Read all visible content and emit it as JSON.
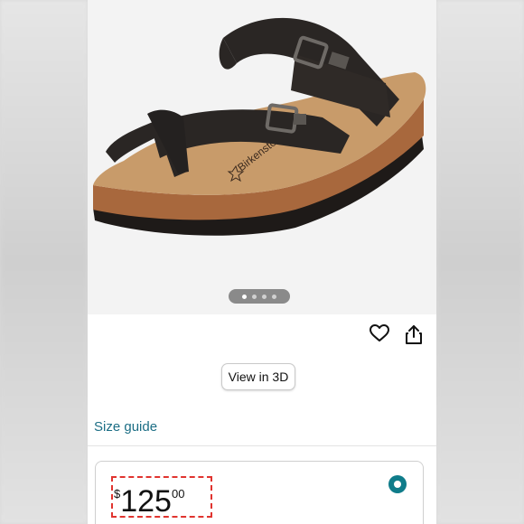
{
  "product": {
    "image_alt": "Black leather toe-loop sandal with two buckle straps and cork footbed",
    "carousel": {
      "total": 4,
      "active": 0
    }
  },
  "actions": {
    "favorite_icon": "heart-icon",
    "share_icon": "share-icon",
    "view_3d_label": "View in 3D"
  },
  "size_guide_label": "Size guide",
  "price": {
    "symbol": "$",
    "whole": "125",
    "fraction": "00",
    "selected": true
  },
  "colors": {
    "link": "#1c6e85",
    "radio": "#0f7c8a",
    "highlight": "#e0342f"
  }
}
